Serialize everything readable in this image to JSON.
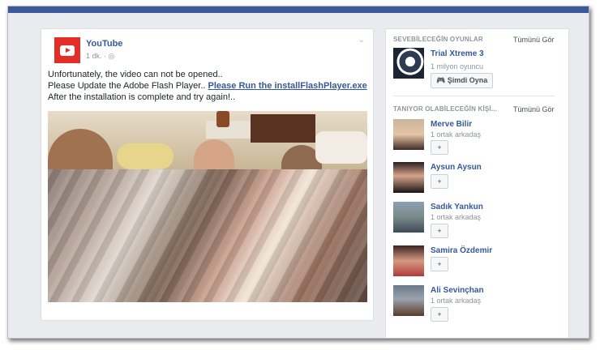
{
  "post": {
    "page_name": "YouTube",
    "time": "1 dk.",
    "globe_icon": "globe-icon",
    "line1": "Unfortunately, the video can not be opened..",
    "line2": "Please Update the Adobe Flash Player.. ",
    "link_text": "Please Run the installFlashPlayer.exe",
    "line3": " After the installation is complete and try again!.."
  },
  "games": {
    "heading": "SEVEBİLECEĞİN OYUNLAR",
    "see_all": "Tümünü Gör",
    "item": {
      "name": "Trial Xtreme 3",
      "meta": "1 milyon oyuncu",
      "play_label": "Şimdi Oyna"
    }
  },
  "people": {
    "heading": "TANIYOR OLABİLECEĞİN KİŞİ...",
    "see_all": "Tümünü Gör",
    "items": [
      {
        "name": "Merve Bilir",
        "meta": "1 ortak arkadaş",
        "add": "+"
      },
      {
        "name": "Aysun Aysun",
        "meta": "",
        "add": "+"
      },
      {
        "name": "Sadık Yankun",
        "meta": "1 ortak arkadaş",
        "add": "+"
      },
      {
        "name": "Samira Özdemir",
        "meta": "",
        "add": "+"
      },
      {
        "name": "Ali Sevinçhan",
        "meta": "1 ortak arkadaş",
        "add": "+"
      }
    ]
  },
  "colors": {
    "brand": "#3b5998",
    "link": "#365899",
    "youtube": "#e52d27"
  }
}
